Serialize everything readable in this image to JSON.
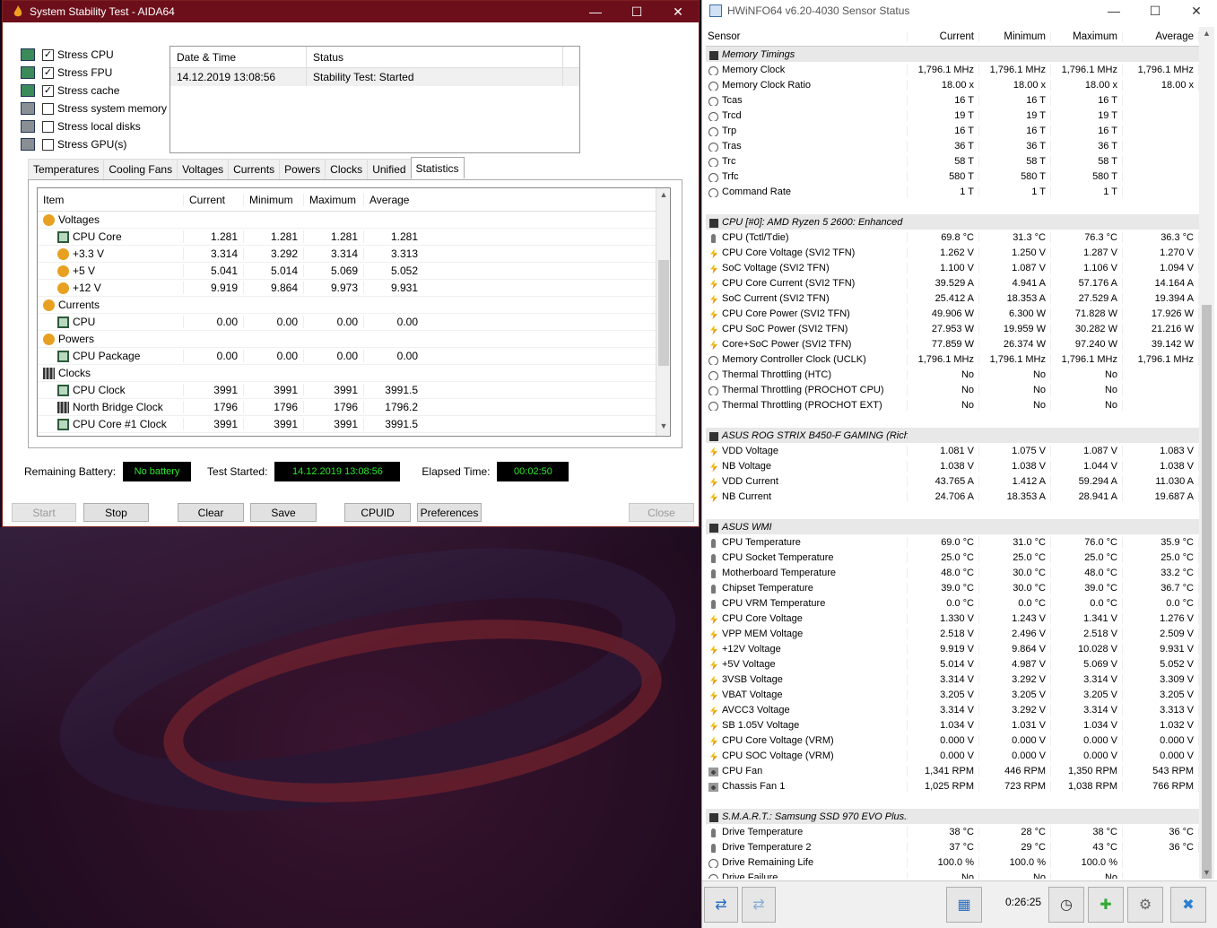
{
  "aida": {
    "title": "System Stability Test - AIDA64",
    "checks": [
      {
        "label": "Stress CPU",
        "checked": true
      },
      {
        "label": "Stress FPU",
        "checked": true
      },
      {
        "label": "Stress cache",
        "checked": true
      },
      {
        "label": "Stress system memory",
        "checked": false
      },
      {
        "label": "Stress local disks",
        "checked": false
      },
      {
        "label": "Stress GPU(s)",
        "checked": false
      }
    ],
    "status_table": {
      "col1": "Date & Time",
      "col2": "Status",
      "row_date": "14.12.2019 13:08:56",
      "row_status": "Stability Test: Started"
    },
    "tabs": [
      "Temperatures",
      "Cooling Fans",
      "Voltages",
      "Currents",
      "Powers",
      "Clocks",
      "Unified",
      "Statistics"
    ],
    "stats_head": [
      "Item",
      "Current",
      "Minimum",
      "Maximum",
      "Average"
    ],
    "stats_rows": [
      {
        "item": "Voltages",
        "group": true,
        "icon": "bolt"
      },
      {
        "item": "CPU Core",
        "icon": "chip",
        "v": [
          "1.281",
          "1.281",
          "1.281",
          "1.281"
        ]
      },
      {
        "item": "+3.3 V",
        "icon": "bolt",
        "v": [
          "3.314",
          "3.292",
          "3.314",
          "3.313"
        ]
      },
      {
        "item": "+5 V",
        "icon": "bolt",
        "v": [
          "5.041",
          "5.014",
          "5.069",
          "5.052"
        ]
      },
      {
        "item": "+12 V",
        "icon": "bolt",
        "v": [
          "9.919",
          "9.864",
          "9.973",
          "9.931"
        ]
      },
      {
        "item": "Currents",
        "group": true,
        "icon": "bolt"
      },
      {
        "item": "CPU",
        "icon": "chip",
        "v": [
          "0.00",
          "0.00",
          "0.00",
          "0.00"
        ]
      },
      {
        "item": "Powers",
        "group": true,
        "icon": "bolt"
      },
      {
        "item": "CPU Package",
        "icon": "chip",
        "v": [
          "0.00",
          "0.00",
          "0.00",
          "0.00"
        ]
      },
      {
        "item": "Clocks",
        "group": true,
        "icon": "clk"
      },
      {
        "item": "CPU Clock",
        "icon": "chip",
        "v": [
          "3991",
          "3991",
          "3991",
          "3991.5"
        ]
      },
      {
        "item": "North Bridge Clock",
        "icon": "clk",
        "v": [
          "1796",
          "1796",
          "1796",
          "1796.2"
        ]
      },
      {
        "item": "CPU Core #1 Clock",
        "icon": "chip",
        "v": [
          "3991",
          "3991",
          "3991",
          "3991.5"
        ]
      }
    ],
    "remaining_battery_label": "Remaining Battery:",
    "remaining_battery": "No battery",
    "test_started_label": "Test Started:",
    "test_started": "14.12.2019 13:08:56",
    "elapsed_label": "Elapsed Time:",
    "elapsed": "00:02:50",
    "buttons": {
      "start": "Start",
      "stop": "Stop",
      "clear": "Clear",
      "save": "Save",
      "cpuid": "CPUID",
      "preferences": "Preferences",
      "close": "Close"
    }
  },
  "hw": {
    "title": "HWiNFO64 v6.20-4030 Sensor Status",
    "head": [
      "Sensor",
      "Current",
      "Minimum",
      "Maximum",
      "Average"
    ],
    "rows": [
      {
        "g": "Memory Timings"
      },
      {
        "n": "Memory Clock",
        "i": "clock",
        "v": [
          "1,796.1 MHz",
          "1,796.1 MHz",
          "1,796.1 MHz",
          "1,796.1 MHz"
        ]
      },
      {
        "n": "Memory Clock Ratio",
        "i": "clock",
        "v": [
          "18.00 x",
          "18.00 x",
          "18.00 x",
          "18.00 x"
        ]
      },
      {
        "n": "Tcas",
        "i": "clock",
        "v": [
          "16 T",
          "16 T",
          "16 T",
          ""
        ]
      },
      {
        "n": "Trcd",
        "i": "clock",
        "v": [
          "19 T",
          "19 T",
          "19 T",
          ""
        ]
      },
      {
        "n": "Trp",
        "i": "clock",
        "v": [
          "16 T",
          "16 T",
          "16 T",
          ""
        ]
      },
      {
        "n": "Tras",
        "i": "clock",
        "v": [
          "36 T",
          "36 T",
          "36 T",
          ""
        ]
      },
      {
        "n": "Trc",
        "i": "clock",
        "v": [
          "58 T",
          "58 T",
          "58 T",
          ""
        ]
      },
      {
        "n": "Trfc",
        "i": "clock",
        "v": [
          "580 T",
          "580 T",
          "580 T",
          ""
        ]
      },
      {
        "n": "Command Rate",
        "i": "clock",
        "v": [
          "1 T",
          "1 T",
          "1 T",
          ""
        ]
      },
      {
        "blank": true
      },
      {
        "g": "CPU [#0]: AMD Ryzen 5 2600: Enhanced"
      },
      {
        "n": "CPU (Tctl/Tdie)",
        "i": "therm",
        "v": [
          "69.8 °C",
          "31.3 °C",
          "76.3 °C",
          "36.3 °C"
        ]
      },
      {
        "n": "CPU Core Voltage (SVI2 TFN)",
        "i": "bolt",
        "v": [
          "1.262 V",
          "1.250 V",
          "1.287 V",
          "1.270 V"
        ]
      },
      {
        "n": "SoC Voltage (SVI2 TFN)",
        "i": "bolt",
        "v": [
          "1.100 V",
          "1.087 V",
          "1.106 V",
          "1.094 V"
        ]
      },
      {
        "n": "CPU Core Current (SVI2 TFN)",
        "i": "bolt",
        "v": [
          "39.529 A",
          "4.941 A",
          "57.176 A",
          "14.164 A"
        ]
      },
      {
        "n": "SoC Current (SVI2 TFN)",
        "i": "bolt",
        "v": [
          "25.412 A",
          "18.353 A",
          "27.529 A",
          "19.394 A"
        ]
      },
      {
        "n": "CPU Core Power (SVI2 TFN)",
        "i": "bolt",
        "v": [
          "49.906 W",
          "6.300 W",
          "71.828 W",
          "17.926 W"
        ]
      },
      {
        "n": "CPU SoC Power (SVI2 TFN)",
        "i": "bolt",
        "v": [
          "27.953 W",
          "19.959 W",
          "30.282 W",
          "21.216 W"
        ]
      },
      {
        "n": "Core+SoC Power (SVI2 TFN)",
        "i": "bolt",
        "v": [
          "77.859 W",
          "26.374 W",
          "97.240 W",
          "39.142 W"
        ]
      },
      {
        "n": "Memory Controller Clock (UCLK)",
        "i": "clock",
        "v": [
          "1,796.1 MHz",
          "1,796.1 MHz",
          "1,796.1 MHz",
          "1,796.1 MHz"
        ]
      },
      {
        "n": "Thermal Throttling (HTC)",
        "i": "clock",
        "v": [
          "No",
          "No",
          "No",
          ""
        ]
      },
      {
        "n": "Thermal Throttling (PROCHOT CPU)",
        "i": "clock",
        "v": [
          "No",
          "No",
          "No",
          ""
        ]
      },
      {
        "n": "Thermal Throttling (PROCHOT EXT)",
        "i": "clock",
        "v": [
          "No",
          "No",
          "No",
          ""
        ]
      },
      {
        "blank": true
      },
      {
        "g": "ASUS ROG STRIX B450-F GAMING (Rich..."
      },
      {
        "n": "VDD Voltage",
        "i": "bolt",
        "v": [
          "1.081 V",
          "1.075 V",
          "1.087 V",
          "1.083 V"
        ]
      },
      {
        "n": "NB Voltage",
        "i": "bolt",
        "v": [
          "1.038 V",
          "1.038 V",
          "1.044 V",
          "1.038 V"
        ]
      },
      {
        "n": "VDD Current",
        "i": "bolt",
        "v": [
          "43.765 A",
          "1.412 A",
          "59.294 A",
          "11.030 A"
        ]
      },
      {
        "n": "NB Current",
        "i": "bolt",
        "v": [
          "24.706 A",
          "18.353 A",
          "28.941 A",
          "19.687 A"
        ]
      },
      {
        "blank": true
      },
      {
        "g": "ASUS WMI"
      },
      {
        "n": "CPU Temperature",
        "i": "therm",
        "v": [
          "69.0 °C",
          "31.0 °C",
          "76.0 °C",
          "35.9 °C"
        ]
      },
      {
        "n": "CPU Socket Temperature",
        "i": "therm",
        "v": [
          "25.0 °C",
          "25.0 °C",
          "25.0 °C",
          "25.0 °C"
        ]
      },
      {
        "n": "Motherboard Temperature",
        "i": "therm",
        "v": [
          "48.0 °C",
          "30.0 °C",
          "48.0 °C",
          "33.2 °C"
        ]
      },
      {
        "n": "Chipset Temperature",
        "i": "therm",
        "v": [
          "39.0 °C",
          "30.0 °C",
          "39.0 °C",
          "36.7 °C"
        ]
      },
      {
        "n": "CPU VRM Temperature",
        "i": "therm",
        "v": [
          "0.0 °C",
          "0.0 °C",
          "0.0 °C",
          "0.0 °C"
        ]
      },
      {
        "n": "CPU Core Voltage",
        "i": "bolt",
        "v": [
          "1.330 V",
          "1.243 V",
          "1.341 V",
          "1.276 V"
        ]
      },
      {
        "n": "VPP MEM Voltage",
        "i": "bolt",
        "v": [
          "2.518 V",
          "2.496 V",
          "2.518 V",
          "2.509 V"
        ]
      },
      {
        "n": "+12V Voltage",
        "i": "bolt",
        "v": [
          "9.919 V",
          "9.864 V",
          "10.028 V",
          "9.931 V"
        ]
      },
      {
        "n": "+5V Voltage",
        "i": "bolt",
        "v": [
          "5.014 V",
          "4.987 V",
          "5.069 V",
          "5.052 V"
        ]
      },
      {
        "n": "3VSB Voltage",
        "i": "bolt",
        "v": [
          "3.314 V",
          "3.292 V",
          "3.314 V",
          "3.309 V"
        ]
      },
      {
        "n": "VBAT Voltage",
        "i": "bolt",
        "v": [
          "3.205 V",
          "3.205 V",
          "3.205 V",
          "3.205 V"
        ]
      },
      {
        "n": "AVCC3 Voltage",
        "i": "bolt",
        "v": [
          "3.314 V",
          "3.292 V",
          "3.314 V",
          "3.313 V"
        ]
      },
      {
        "n": "SB 1.05V Voltage",
        "i": "bolt",
        "v": [
          "1.034 V",
          "1.031 V",
          "1.034 V",
          "1.032 V"
        ]
      },
      {
        "n": "CPU Core Voltage (VRM)",
        "i": "bolt",
        "v": [
          "0.000 V",
          "0.000 V",
          "0.000 V",
          "0.000 V"
        ]
      },
      {
        "n": "CPU SOC Voltage (VRM)",
        "i": "bolt",
        "v": [
          "0.000 V",
          "0.000 V",
          "0.000 V",
          "0.000 V"
        ]
      },
      {
        "n": "CPU Fan",
        "i": "fan",
        "v": [
          "1,341 RPM",
          "446 RPM",
          "1,350 RPM",
          "543 RPM"
        ]
      },
      {
        "n": "Chassis Fan 1",
        "i": "fan",
        "v": [
          "1,025 RPM",
          "723 RPM",
          "1,038 RPM",
          "766 RPM"
        ]
      },
      {
        "blank": true
      },
      {
        "g": "S.M.A.R.T.: Samsung SSD 970 EVO Plus..."
      },
      {
        "n": "Drive Temperature",
        "i": "therm",
        "v": [
          "38 °C",
          "28 °C",
          "38 °C",
          "36 °C"
        ]
      },
      {
        "n": "Drive Temperature 2",
        "i": "therm",
        "v": [
          "37 °C",
          "29 °C",
          "43 °C",
          "36 °C"
        ]
      },
      {
        "n": "Drive Remaining Life",
        "i": "clock",
        "v": [
          "100.0 %",
          "100.0 %",
          "100.0 %",
          ""
        ]
      },
      {
        "n": "Drive Failure",
        "i": "clock",
        "v": [
          "No",
          "No",
          "No",
          ""
        ]
      }
    ],
    "elapsed": "0:26:25"
  }
}
